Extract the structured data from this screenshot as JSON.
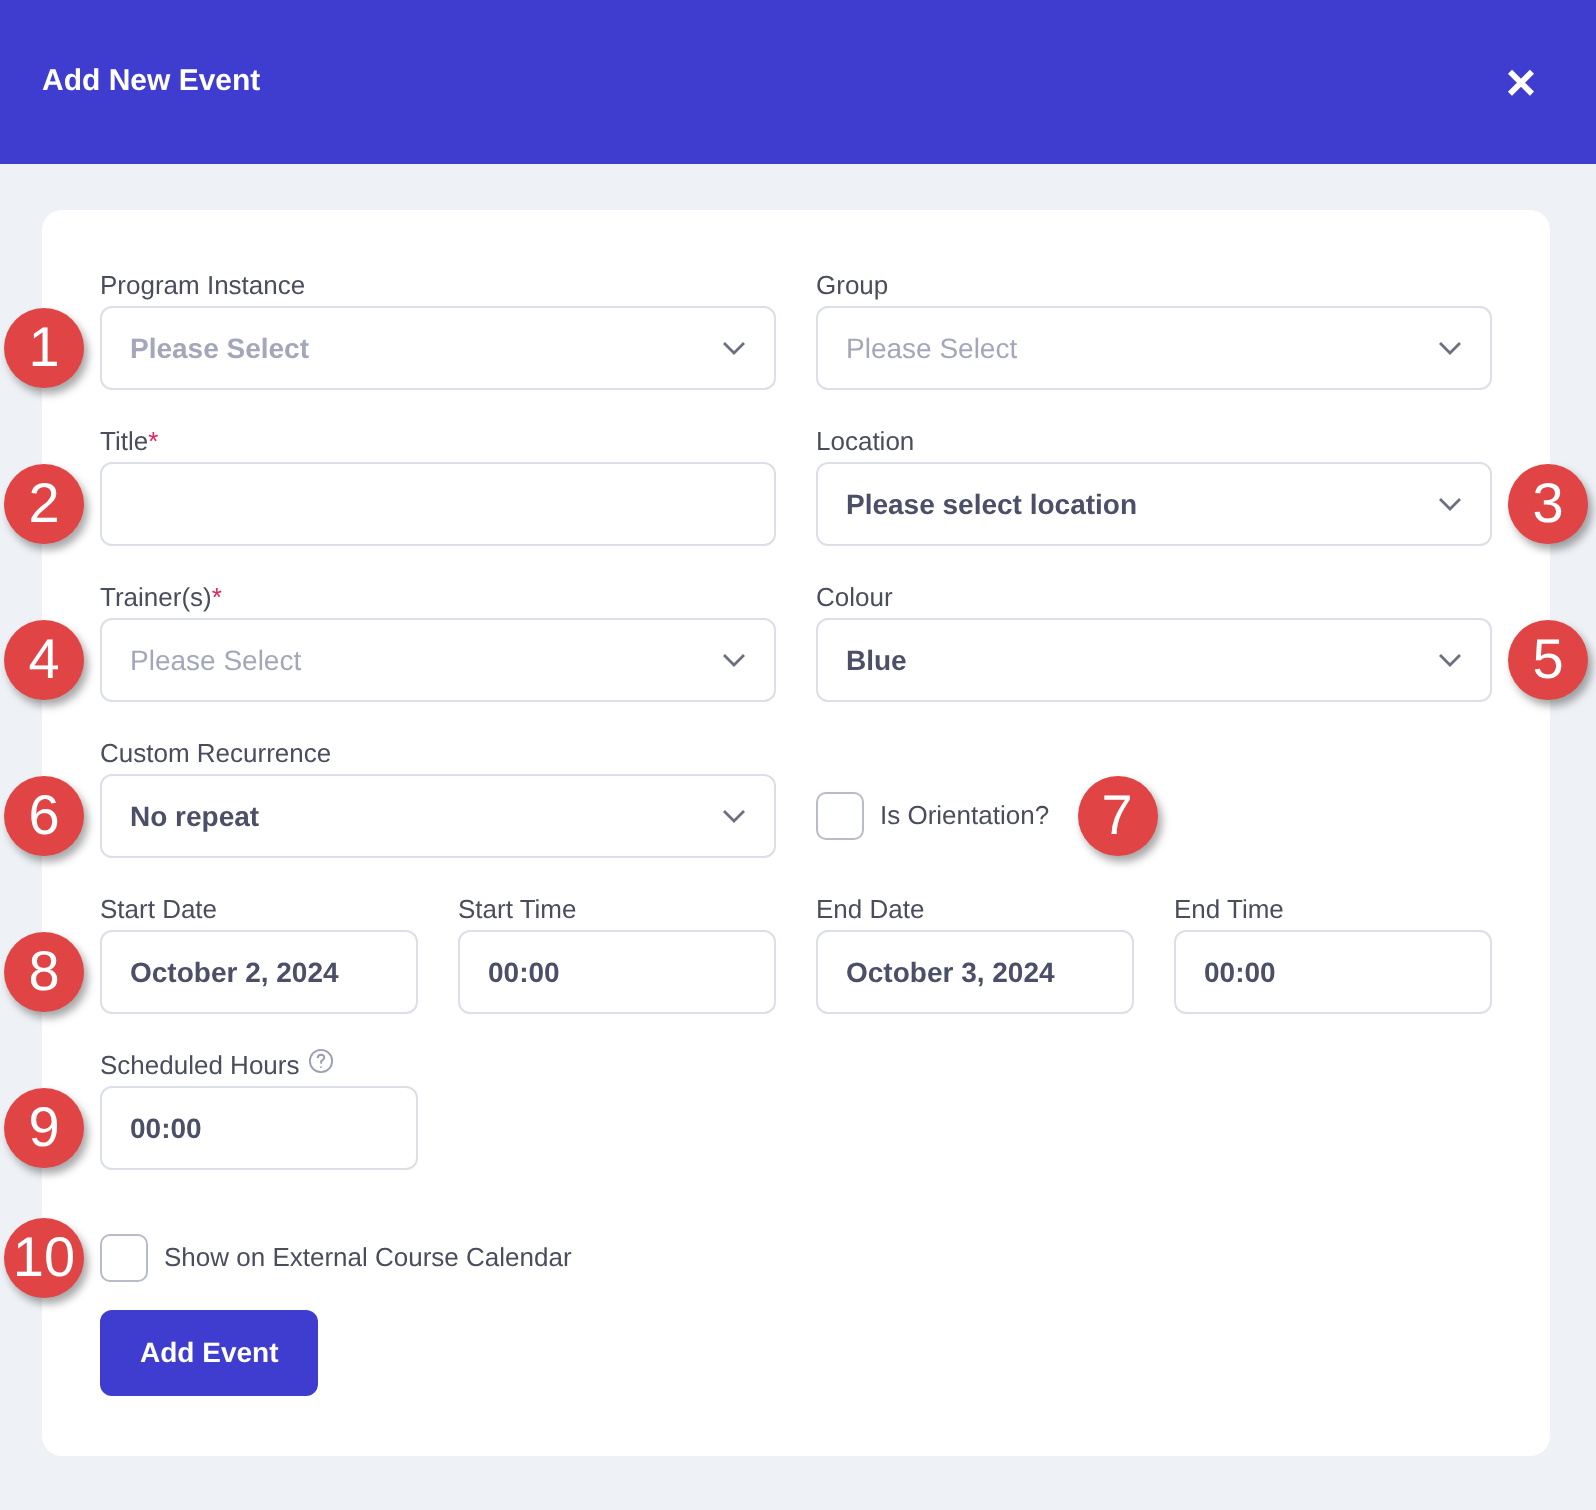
{
  "header": {
    "title": "Add New Event",
    "close": "×"
  },
  "fields": [
    {
      "kind": "select",
      "label": "Program Instance",
      "placeholder": "Please Select",
      "marker": "1"
    },
    {
      "kind": "select",
      "label": "Group",
      "placeholder": "Please Select"
    },
    {
      "kind": "text",
      "label": "Title",
      "required_mark": "*",
      "marker": "2"
    },
    {
      "kind": "select",
      "label": "Location",
      "value": "Please select location",
      "marker": "3"
    },
    {
      "kind": "select",
      "label": "Trainer(s)",
      "required_mark": "*",
      "placeholder": "Please Select",
      "marker": "4"
    },
    {
      "kind": "select",
      "label": "Colour",
      "value": "Blue",
      "marker": "5"
    },
    {
      "kind": "select",
      "label": "Custom Recurrence",
      "value": "No repeat",
      "marker": "6"
    },
    {
      "kind": "checkbox",
      "label": "Is Orientation?",
      "checked": false,
      "marker": "7"
    }
  ],
  "schedule": {
    "marker": "8",
    "fields": [
      {
        "label": "Start Date",
        "value": "October 2, 2024"
      },
      {
        "label": "Start Time",
        "value": "00:00"
      },
      {
        "label": "End Date",
        "value": "October 3, 2024"
      },
      {
        "label": "End Time",
        "value": "00:00"
      }
    ]
  },
  "scheduled_hours": {
    "label": "Scheduled Hours",
    "value": "00:00",
    "marker": "9"
  },
  "external_calendar": {
    "label": "Show on External Course Calendar",
    "checked": false,
    "marker": "10"
  },
  "submit": "Add Event"
}
